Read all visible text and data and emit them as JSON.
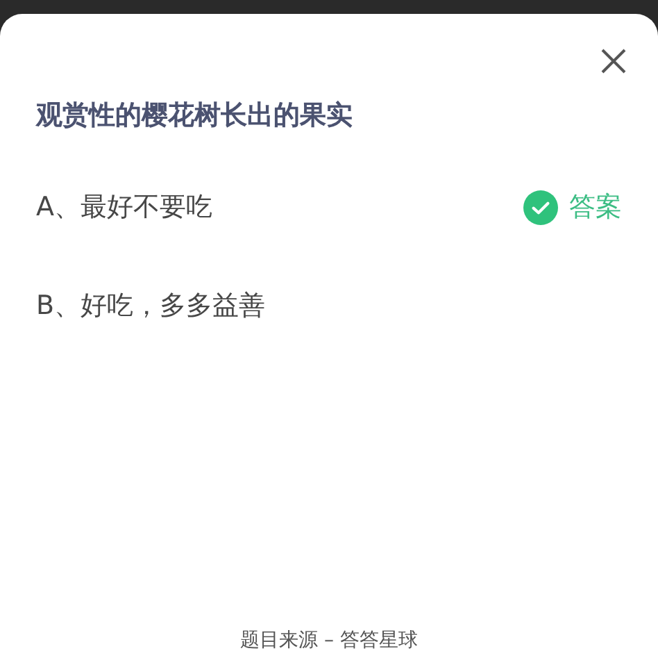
{
  "question": "观赏性的樱花树长出的果实",
  "options": [
    {
      "label": "A、最好不要吃",
      "correct": true
    },
    {
      "label": "B、好吃，多多益善",
      "correct": false
    }
  ],
  "answer_label": "答案",
  "footer": "题目来源 – 答答星球"
}
